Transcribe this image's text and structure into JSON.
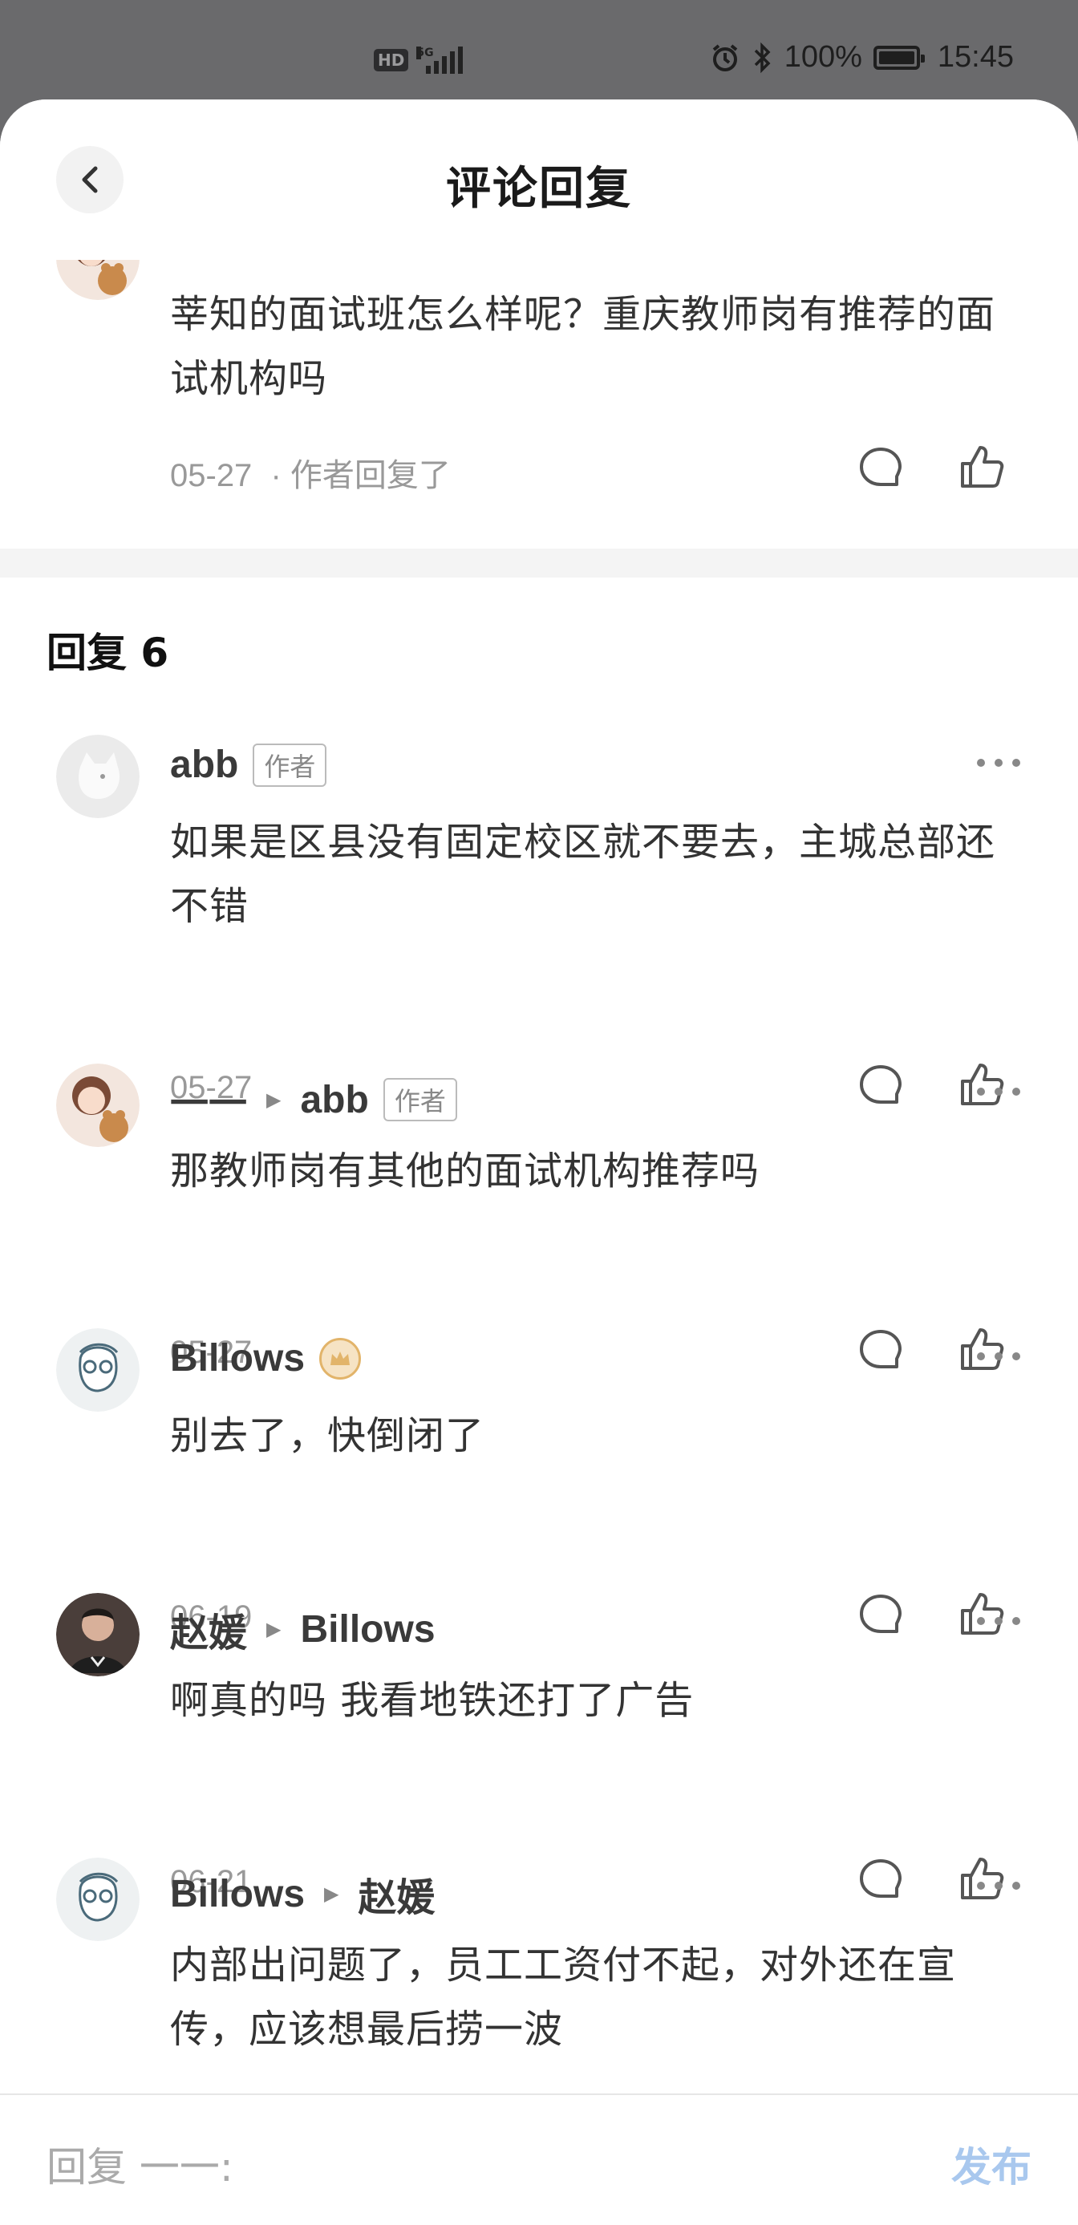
{
  "status_bar": {
    "network_hd": "HD",
    "network_gen": "5G",
    "battery_text": "100%",
    "time": "15:45"
  },
  "header": {
    "title": "评论回复"
  },
  "original_comment": {
    "text": "莘知的面试班怎么样呢？重庆教师岗有推荐的面试机构吗",
    "date": "05-27",
    "meta_suffix": "· 作者回复了"
  },
  "replies_section": {
    "title": "回复 6"
  },
  "replies": [
    {
      "author": "abb",
      "tag": "作者",
      "text": "如果是区县没有固定校区就不要去，主城总部还不错",
      "date": "05-27"
    },
    {
      "author": "一一",
      "reply_to": "abb",
      "reply_to_tag": "作者",
      "text": "那教师岗有其他的面试机构推荐吗",
      "date": "05-27"
    },
    {
      "author": "Billows",
      "text": "别去了，快倒闭了",
      "date": "06-19"
    },
    {
      "author": "赵媛",
      "reply_to": "Billows",
      "text": "啊真的吗 我看地铁还打了广告",
      "date": "06-21"
    },
    {
      "author": "Billows",
      "reply_to": "赵媛",
      "text": "内部出问题了，员工工资付不起，对外还在宣传，应该想最后捞一波"
    }
  ],
  "bottom_bar": {
    "placeholder": "回复 一一:",
    "publish_label": "发布"
  },
  "colors": {
    "publish": "#a9c8ee",
    "status_bg": "#6a6a6c",
    "crown": "#e2b46a"
  }
}
